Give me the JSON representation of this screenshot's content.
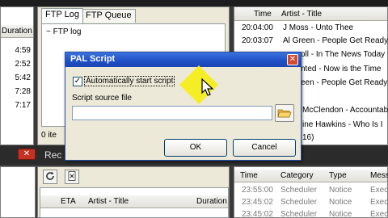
{
  "left_panel": {
    "header": "Duration",
    "durations": [
      "4:59",
      "2:52",
      "5:42",
      "7:28",
      "7:17"
    ]
  },
  "ftp_panel": {
    "tabs": [
      "FTP Log",
      "FTP Queue"
    ],
    "tree_root": "FTP log",
    "status": "0 ite"
  },
  "history_panel": {
    "headers": [
      "Time",
      "Artist - Title"
    ],
    "rows": [
      {
        "time": "20:04:00",
        "title": "J Moss - Unto Thee"
      },
      {
        "time": "20:03:07",
        "title": "Al Green - People Get Ready"
      },
      {
        "time": "",
        "title": "oll - In The News Today"
      },
      {
        "time": "",
        "title": "nted - Now is the Time"
      },
      {
        "time": "",
        "title": "een - People Get Ready"
      },
      {
        "time": "",
        "title": "McClendon - Accountab"
      },
      {
        "time": "",
        "title": "ine Hawkins - Who Is I"
      }
    ],
    "status": "16)"
  },
  "bottom_bar": {
    "close_label": "✕",
    "rec_label": "Rec"
  },
  "queue_panel": {
    "headers": [
      "ETA",
      "Artist - Title",
      "Duration"
    ]
  },
  "log_panel": {
    "headers": [
      "Time",
      "Category",
      "Type",
      "Mess"
    ],
    "rows": [
      {
        "time": "23:55:00",
        "category": "Scheduler",
        "type": "Notice",
        "message": "Exec"
      },
      {
        "time": "23:45:02",
        "category": "Scheduler",
        "type": "Notice",
        "message": "Exec"
      },
      {
        "time": "23:45:02",
        "category": "Scheduler",
        "type": "Notice",
        "message": "Exec"
      }
    ]
  },
  "dialog": {
    "title": "PAL Script",
    "checkbox_label": "Automatically start script",
    "checkbox_checked": "✓",
    "source_label": "Script source file",
    "source_value": "",
    "ok_label": "OK",
    "cancel_label": "Cancel"
  },
  "colors": {
    "titlebar": "#1f4fc4",
    "dialog_bg": "#ece9d8",
    "highlight": "#f5ee1e"
  }
}
